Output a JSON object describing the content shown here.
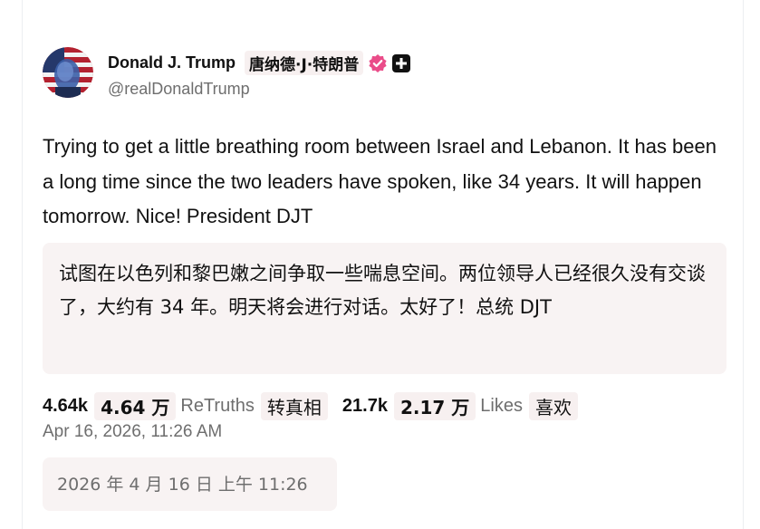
{
  "post": {
    "author": {
      "display_name": "Donald J. Trump",
      "display_name_translation": "唐纳德·J·特朗普",
      "handle": "@realDonaldTrump",
      "verified": true,
      "avatar_icon": "avatar-portrait-flag"
    },
    "text": "Trying to get a little breathing room between Israel and Lebanon. It has been a long time since the two leaders have spoken, like 34 years. It will happen tomorrow. Nice! President DJT",
    "translation": "试图在以色列和黎巴嫩之间争取一些喘息空间。两位领导人已经很久没有交谈了，大约有 34 年。明天将会进行对话。太好了！总统 DJT",
    "stats": {
      "retruths": "4.64k",
      "retruths_translation_value": "4.64 万",
      "retruths_label": "ReTruths",
      "retruths_label_translation": "转真相",
      "likes": "21.7k",
      "likes_translation_value": "2.17 万",
      "likes_label": "Likes",
      "likes_label_translation": "喜欢"
    },
    "timestamp": "Apr 16, 2026, 11:26 AM",
    "timestamp_translation": "2026 年 4 月 16 日 上午 11:26"
  },
  "colors": {
    "verified_badge": "#ea4c89",
    "translation_bg": "#f8f3f3",
    "muted_text": "#6e6e6e"
  }
}
